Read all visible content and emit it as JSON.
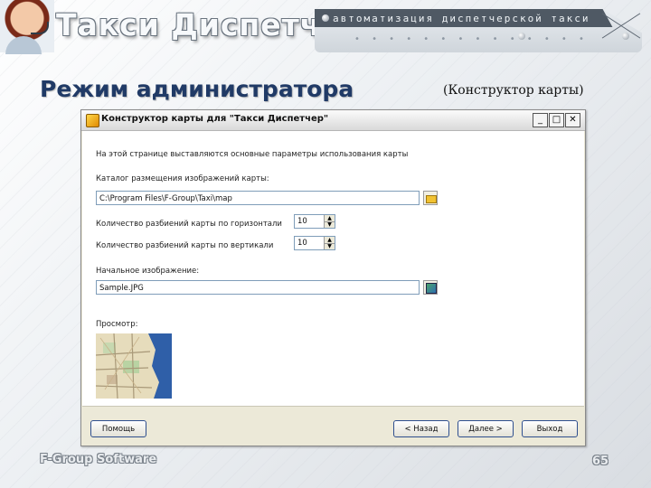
{
  "header": {
    "title": "Такси Диспетчер",
    "subtitle": "автоматизация диспетчерской такси",
    "dots": "• • • • • • • • • • • • • •"
  },
  "slide": {
    "title": "Режим администратора",
    "subtitle": "(Конструктор карты)",
    "footer_company": "F-Group Software",
    "page_number": "65"
  },
  "dialog": {
    "title": "Конструктор карты для \"Такси Диспетчер\"",
    "minimize": "_",
    "maximize": "□",
    "close": "✕",
    "intro": "На этой странице выставляются основные параметры использования карты",
    "folder_label": "Каталог размещения изображений карты:",
    "folder_value": "C:\\Program Files\\F-Group\\Taxi\\map",
    "horiz_label": "Количество разбиений карты по горизонтали",
    "horiz_value": "10",
    "vert_label": "Количество разбиений карты по вертикали",
    "vert_value": "10",
    "image_label": "Начальное изображение:",
    "image_value": "Sample.JPG",
    "preview_label": "Просмотр:",
    "buttons": {
      "help": "Помощь",
      "back": "< Назад",
      "next": "Далее >",
      "exit": "Выход"
    }
  },
  "colors": {
    "slide_title": "#203a66",
    "dialog_bg": "#ece9d8",
    "button_border": "#2f4f8f"
  }
}
